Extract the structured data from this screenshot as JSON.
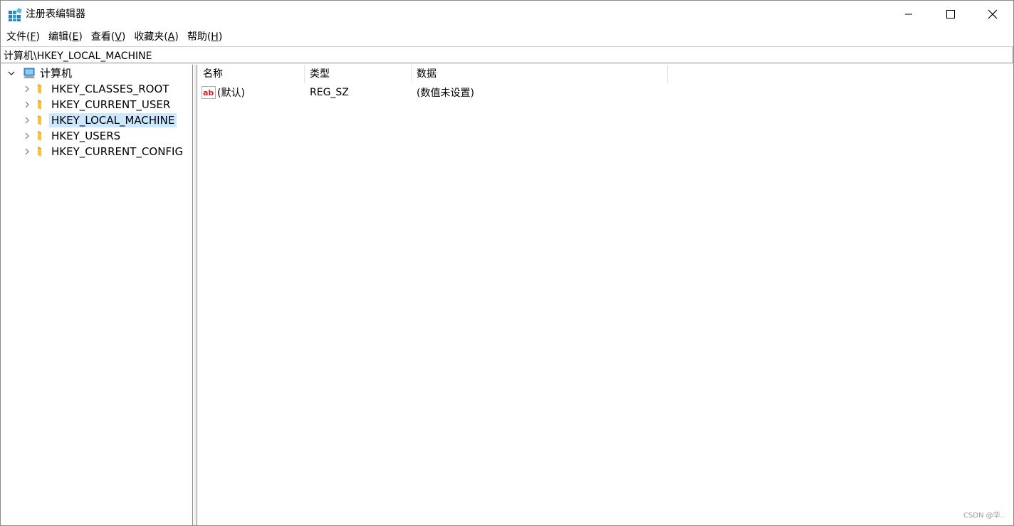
{
  "window": {
    "title": "注册表编辑器"
  },
  "menu": [
    {
      "label": "文件(",
      "key": "F",
      "tail": ")"
    },
    {
      "label": "编辑(",
      "key": "E",
      "tail": ")"
    },
    {
      "label": "查看(",
      "key": "V",
      "tail": ")"
    },
    {
      "label": "收藏夹(",
      "key": "A",
      "tail": ")"
    },
    {
      "label": "帮助(",
      "key": "H",
      "tail": ")"
    }
  ],
  "address": {
    "value": "计算机\\HKEY_LOCAL_MACHINE"
  },
  "tree": {
    "root": "计算机",
    "items": [
      {
        "label": "HKEY_CLASSES_ROOT"
      },
      {
        "label": "HKEY_CURRENT_USER"
      },
      {
        "label": "HKEY_LOCAL_MACHINE",
        "selected": true
      },
      {
        "label": "HKEY_USERS"
      },
      {
        "label": "HKEY_CURRENT_CONFIG"
      }
    ]
  },
  "list": {
    "columns": [
      "名称",
      "类型",
      "数据"
    ],
    "rows": [
      {
        "name": "(默认)",
        "type": "REG_SZ",
        "data": "(数值未设置)"
      }
    ]
  },
  "watermark": "CSDN @华.."
}
